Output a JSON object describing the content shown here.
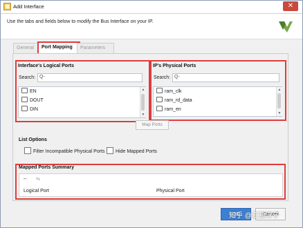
{
  "window": {
    "title": "Add Interface",
    "close_glyph": "✕",
    "header_text": "Use the tabs and fields below to modify the Bus Interface on your IP."
  },
  "tabs": [
    {
      "label": "General"
    },
    {
      "label": "Port Mapping"
    },
    {
      "label": "Parameters"
    }
  ],
  "logical_ports": {
    "title": "Interface's Logical Ports",
    "search_label": "Search:",
    "search_placeholder": "Q-",
    "items": [
      "EN",
      "DOUT",
      "DIN"
    ]
  },
  "physical_ports": {
    "title": "IP's Physical Ports",
    "search_label": "Search:",
    "search_placeholder": "Q-",
    "items": [
      "ram_clk",
      "ram_rd_data",
      "ram_en"
    ]
  },
  "map_ports_button": "Map Ports",
  "list_options": {
    "title": "List Options",
    "filter_label": "Filter Incompatible Physical Ports",
    "hide_label": "Hide Mapped Ports"
  },
  "summary": {
    "title": "Mapped Ports Summary",
    "col_logical": "Logical Port",
    "col_physical": "Physical Port"
  },
  "footer": {
    "ok": "OK",
    "cancel": "Cancel",
    "watermark": "知乎 @江猫淳子"
  },
  "colors": {
    "highlight": "#e03b3b",
    "ok_button": "#3c7fd3"
  }
}
